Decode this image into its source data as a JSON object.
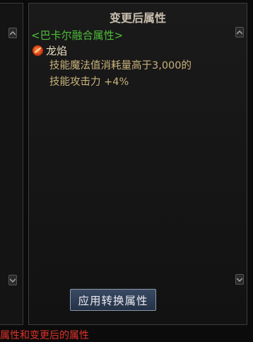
{
  "right_panel": {
    "title": "变更后属性",
    "section_header": "<巴卡尔融合属性>",
    "skill_name": "龙焰",
    "effect_lines": [
      "技能魔法值消耗量高于3,000的",
      "技能攻击力 +4%"
    ]
  },
  "buttons": {
    "apply": "应用转换属性"
  },
  "footer": {
    "text": "属性和变更后的属性"
  },
  "icons": {
    "skill": "dragon-flame-icon",
    "scroll_up": "chevron-up-icon",
    "scroll_down": "chevron-down-icon"
  }
}
